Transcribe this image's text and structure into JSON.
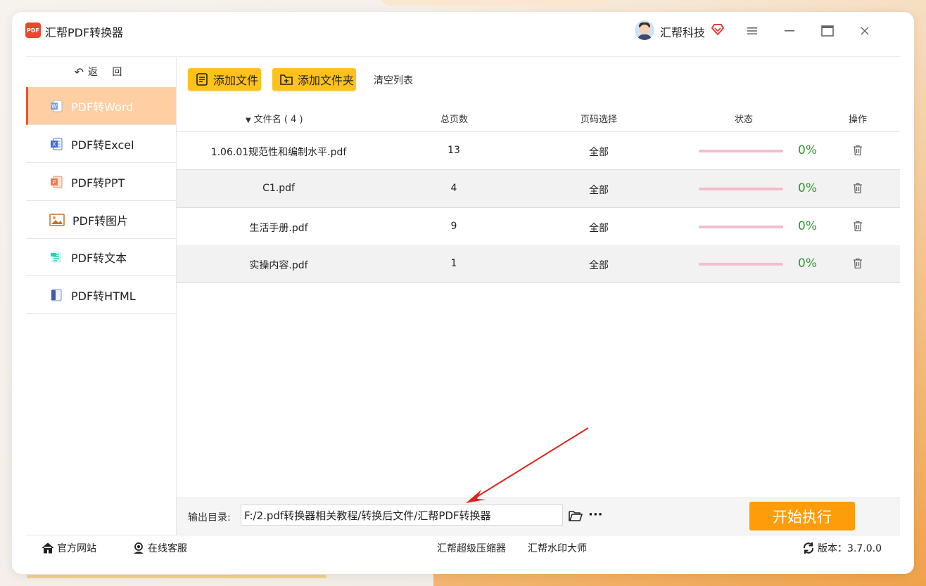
{
  "app": {
    "title": "汇帮PDF转换器",
    "logo_text": "PDF"
  },
  "user": {
    "name": "汇帮科技"
  },
  "window_controls": {
    "menu": "≡",
    "minimize": "—",
    "maximize": "▭",
    "close": "✕"
  },
  "sidebar": {
    "back_label": "返 回",
    "items": [
      {
        "label": "PDF转Word",
        "icon": "word-icon",
        "active": true
      },
      {
        "label": "PDF转Excel",
        "icon": "excel-icon",
        "active": false
      },
      {
        "label": "PDF转PPT",
        "icon": "ppt-icon",
        "active": false
      },
      {
        "label": "PDF转图片",
        "icon": "image-icon",
        "active": false
      },
      {
        "label": "PDF转文本",
        "icon": "text-icon",
        "active": false
      },
      {
        "label": "PDF转HTML",
        "icon": "html-icon",
        "active": false
      }
    ]
  },
  "toolbar": {
    "add_file": "添加文件",
    "add_folder": "添加文件夹",
    "clear_list": "清空列表"
  },
  "table": {
    "headers": {
      "name": "文件名 ( 4 )",
      "pages": "总页数",
      "range": "页码选择",
      "status": "状态",
      "action": "操作"
    },
    "rows": [
      {
        "name": "1.06.01规范性和编制水平.pdf",
        "pages": "13",
        "range": "全部",
        "progress": "0%"
      },
      {
        "name": "C1.pdf",
        "pages": "4",
        "range": "全部",
        "progress": "0%"
      },
      {
        "name": "生活手册.pdf",
        "pages": "9",
        "range": "全部",
        "progress": "0%"
      },
      {
        "name": "实操内容.pdf",
        "pages": "1",
        "range": "全部",
        "progress": "0%"
      }
    ]
  },
  "output": {
    "label": "输出目录:",
    "path": "F:/2.pdf转换器相关教程/转换后文件/汇帮PDF转换器",
    "more": "···"
  },
  "start_button": "开始执行",
  "footer": {
    "website": "官方网站",
    "support": "在线客服",
    "compressor": "汇帮超级压缩器",
    "watermark": "汇帮水印大师",
    "version": "版本：3.7.0.0"
  },
  "colors": {
    "accent": "#ffc21a",
    "start": "#ff9c0a",
    "active_nav": "#ffcfa3",
    "progress_ok": "#2e9a2e",
    "progress_track": "#f5bccb"
  }
}
